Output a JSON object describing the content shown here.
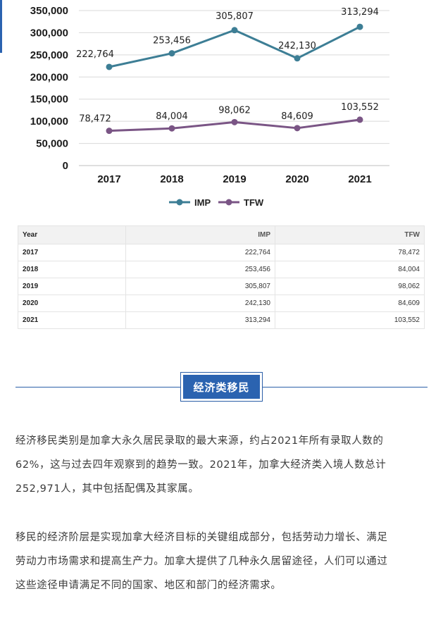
{
  "chart_data": {
    "type": "line",
    "categories": [
      "2017",
      "2018",
      "2019",
      "2020",
      "2021"
    ],
    "series": [
      {
        "name": "IMP",
        "values": [
          222764,
          253456,
          305807,
          242130,
          313294
        ],
        "labels": [
          "222,764",
          "253,456",
          "305,807",
          "242,130",
          "313,294"
        ],
        "color": "#3d7e95"
      },
      {
        "name": "TFW",
        "values": [
          78472,
          84004,
          98062,
          84609,
          103552
        ],
        "labels": [
          "78,472",
          "84,004",
          "98,062",
          "84,609",
          "103,552"
        ],
        "color": "#7a5585"
      }
    ],
    "ylim": [
      0,
      350000
    ],
    "yticks": [
      "0",
      "50,000",
      "100,000",
      "150,000",
      "200,000",
      "250,000",
      "300,000",
      "350,000"
    ],
    "grid": true,
    "legend_position": "bottom"
  },
  "table": {
    "headers": [
      "Year",
      "IMP",
      "TFW"
    ],
    "rows": [
      [
        "2017",
        "222,764",
        "78,472"
      ],
      [
        "2018",
        "253,456",
        "84,004"
      ],
      [
        "2019",
        "305,807",
        "98,062"
      ],
      [
        "2020",
        "242,130",
        "84,609"
      ],
      [
        "2021",
        "313,294",
        "103,552"
      ]
    ]
  },
  "section": {
    "title": "经济类移民"
  },
  "paragraphs": [
    [
      "经济移民类别是加拿大永久居民录取的最大来源，约占2021年所有录取人数的",
      "62%，这与过去四年观察到的趋势一致。2021年，加拿大经济类入境人数总计",
      "252,971人，其中包括配偶及其家属。"
    ],
    [
      "移民的经济阶层是实现加拿大经济目标的关键组成部分，包括劳动力增长、满足",
      "劳动力市场需求和提高生产力。加拿大提供了几种永久居留途径，人们可以通过",
      "这些途径申请满足不同的国家、地区和部门的经济需求。"
    ]
  ],
  "colors": {
    "accent": "#2b63b0",
    "imp": "#3d7e95",
    "tfw": "#7a5585"
  }
}
